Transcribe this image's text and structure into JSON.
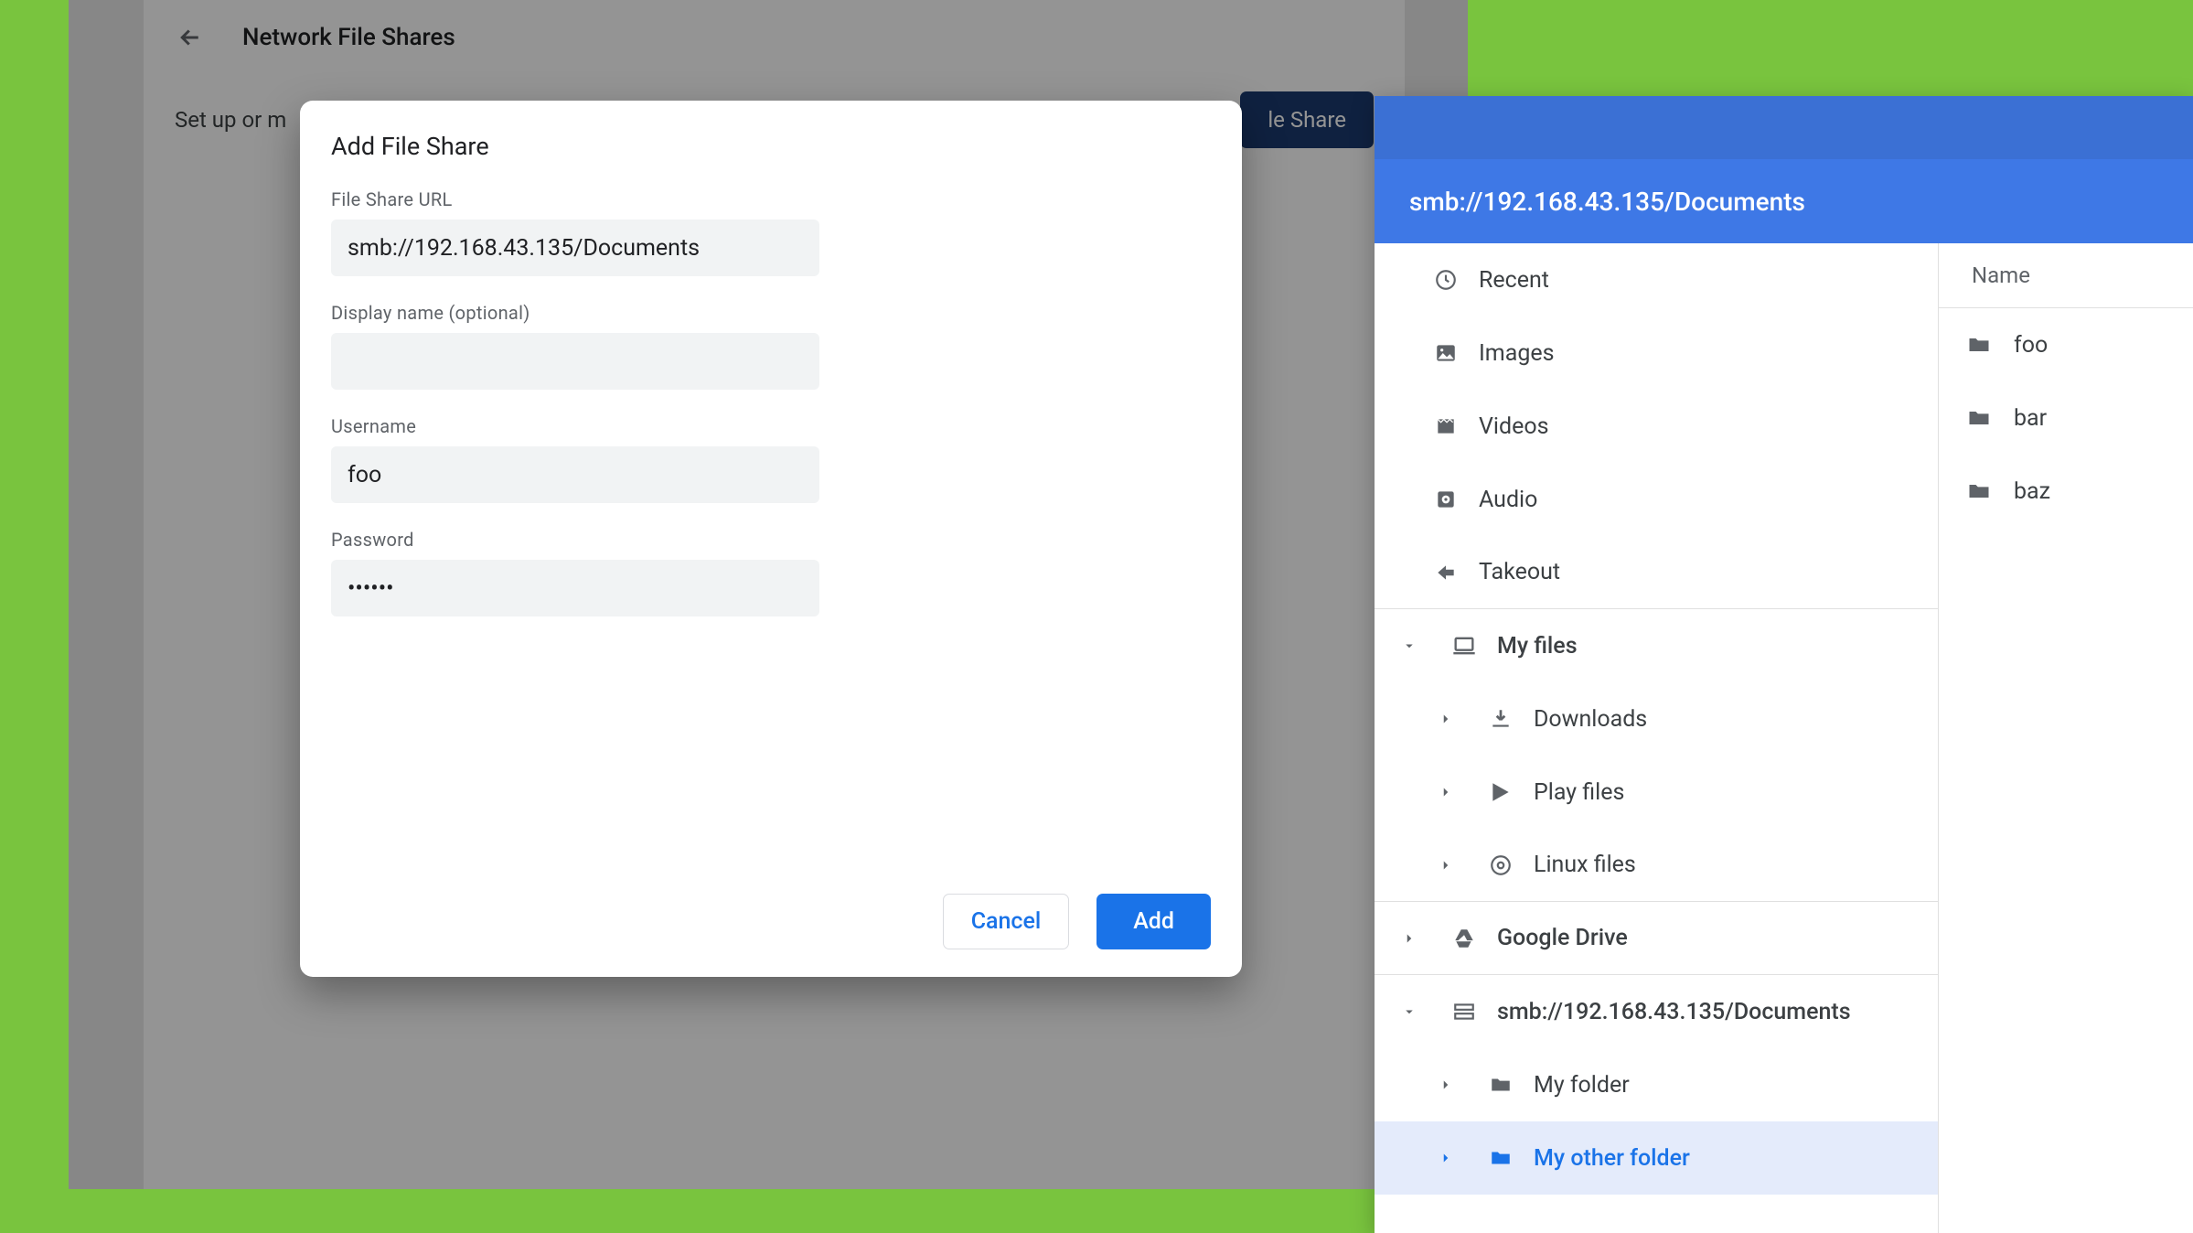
{
  "settings": {
    "page_title": "Network File Shares",
    "subtext": "Set up or m",
    "add_button_partial": "le Share"
  },
  "dialog": {
    "title": "Add File Share",
    "labels": {
      "url": "File Share URL",
      "display_name": "Display name (optional)",
      "username": "Username",
      "password": "Password"
    },
    "values": {
      "url": "smb://192.168.43.135/Documents",
      "display_name": "",
      "username": "foo",
      "password": "••••••"
    },
    "buttons": {
      "cancel": "Cancel",
      "add": "Add"
    }
  },
  "files_app": {
    "header_path": "smb://192.168.43.135/Documents",
    "content": {
      "column_header": "Name",
      "items": [
        "foo",
        "bar",
        "baz"
      ]
    },
    "sidebar": {
      "recent": "Recent",
      "images": "Images",
      "videos": "Videos",
      "audio": "Audio",
      "takeout": "Takeout",
      "my_files": "My files",
      "downloads": "Downloads",
      "play_files": "Play files",
      "linux_files": "Linux files",
      "google_drive": "Google Drive",
      "smb_share": "smb://192.168.43.135/Documents",
      "my_folder": "My folder",
      "my_other_folder": "My other folder"
    }
  }
}
